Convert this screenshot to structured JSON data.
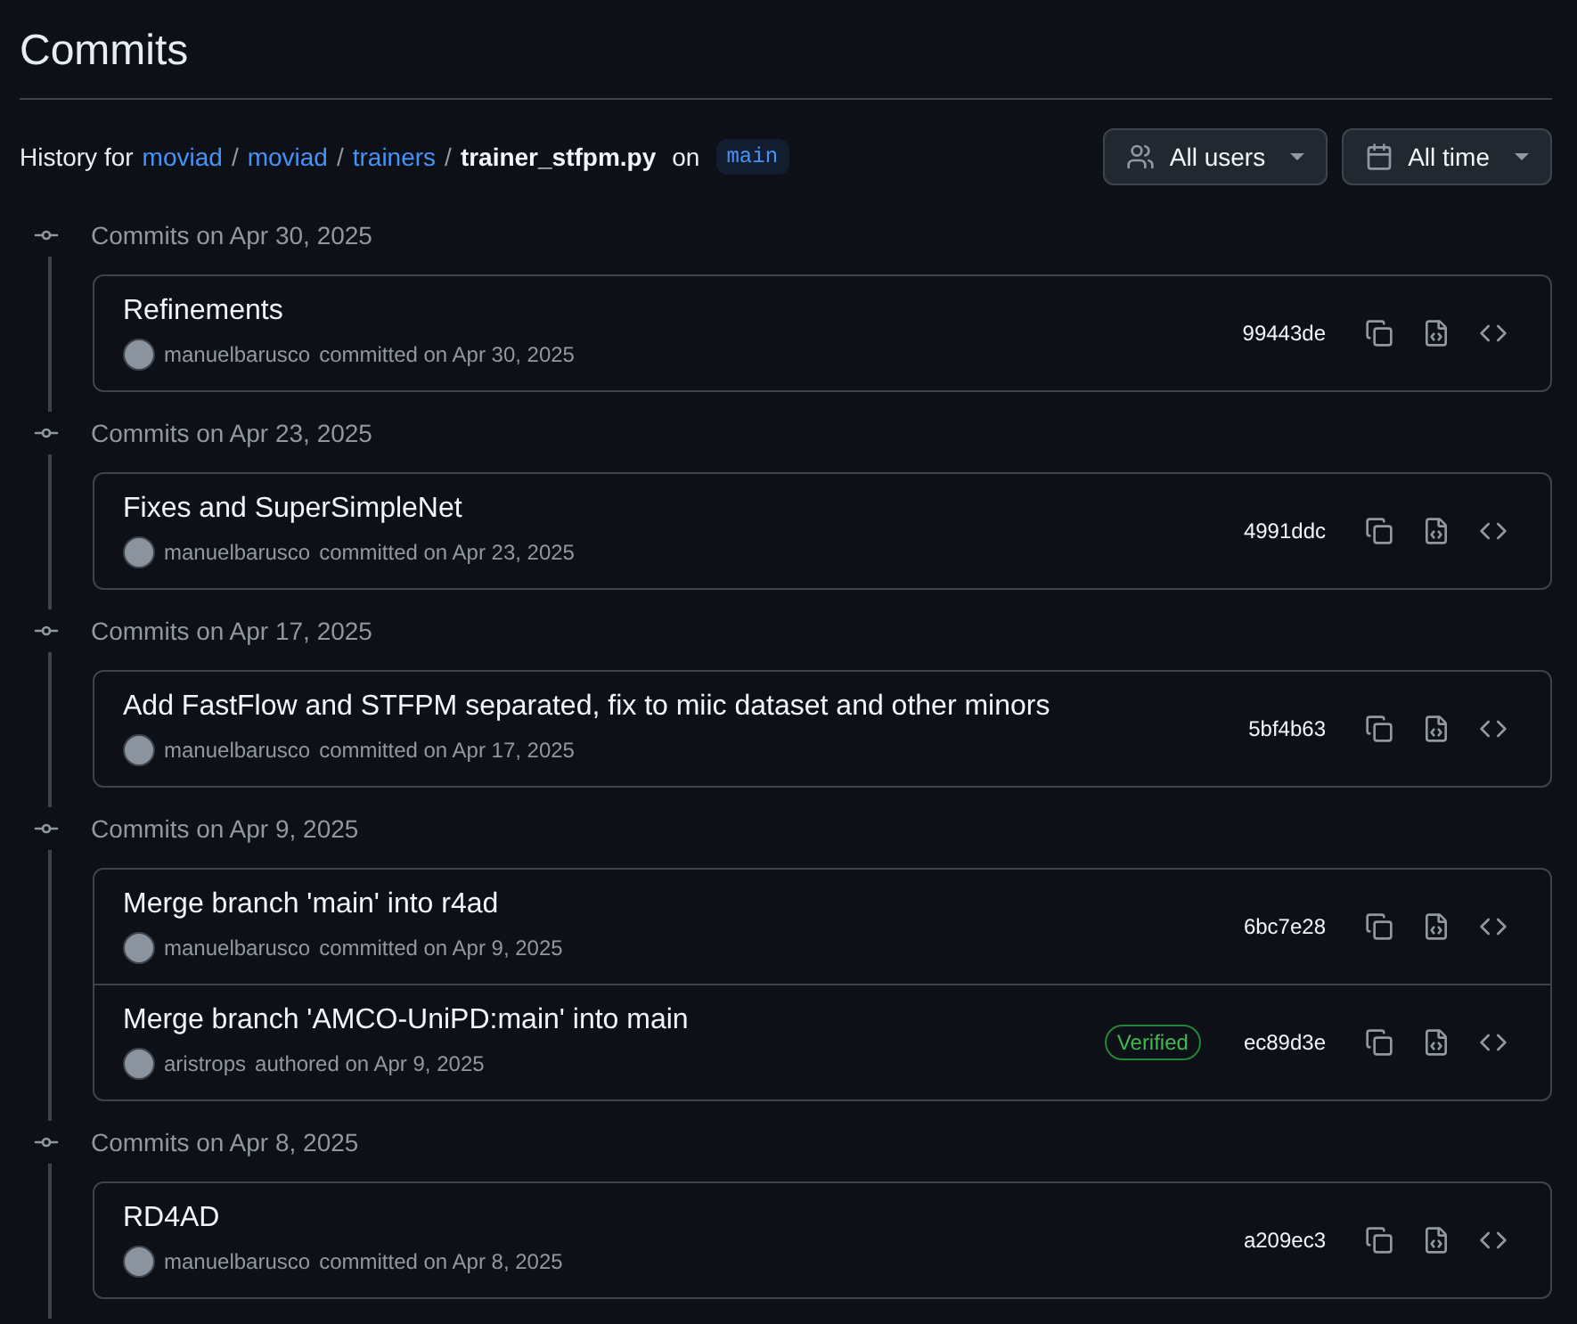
{
  "title": "Commits",
  "history": {
    "label": "History for",
    "path": [
      "moviad",
      "moviad",
      "trainers"
    ],
    "separator": "/",
    "file": "trainer_stfpm.py",
    "on": "on",
    "branch": "main"
  },
  "filters": [
    {
      "kind": "users",
      "label": "All users"
    },
    {
      "kind": "time",
      "label": "All time"
    }
  ],
  "groups": [
    {
      "heading": "Commits on Apr 30, 2025",
      "commits": [
        {
          "message": "Refinements",
          "author": "manuelbarusco",
          "action": "committed on Apr 30, 2025",
          "sha": "99443de"
        }
      ]
    },
    {
      "heading": "Commits on Apr 23, 2025",
      "commits": [
        {
          "message": "Fixes and SuperSimpleNet",
          "author": "manuelbarusco",
          "action": "committed on Apr 23, 2025",
          "sha": "4991ddc"
        }
      ]
    },
    {
      "heading": "Commits on Apr 17, 2025",
      "commits": [
        {
          "message": "Add FastFlow and STFPM separated, fix to miic dataset and other minors",
          "author": "manuelbarusco",
          "action": "committed on Apr 17, 2025",
          "sha": "5bf4b63"
        }
      ]
    },
    {
      "heading": "Commits on Apr 9, 2025",
      "commits": [
        {
          "message": "Merge branch 'main' into r4ad",
          "author": "manuelbarusco",
          "action": "committed on Apr 9, 2025",
          "sha": "6bc7e28"
        },
        {
          "message": "Merge branch 'AMCO-UniPD:main' into main",
          "author": "aristrops",
          "action": "authored on Apr 9, 2025",
          "badge": "Verified",
          "sha": "ec89d3e"
        }
      ]
    },
    {
      "heading": "Commits on Apr 8, 2025",
      "commits": [
        {
          "message": "RD4AD",
          "author": "manuelbarusco",
          "action": "committed on Apr 8, 2025",
          "sha": "a209ec3"
        }
      ]
    }
  ]
}
